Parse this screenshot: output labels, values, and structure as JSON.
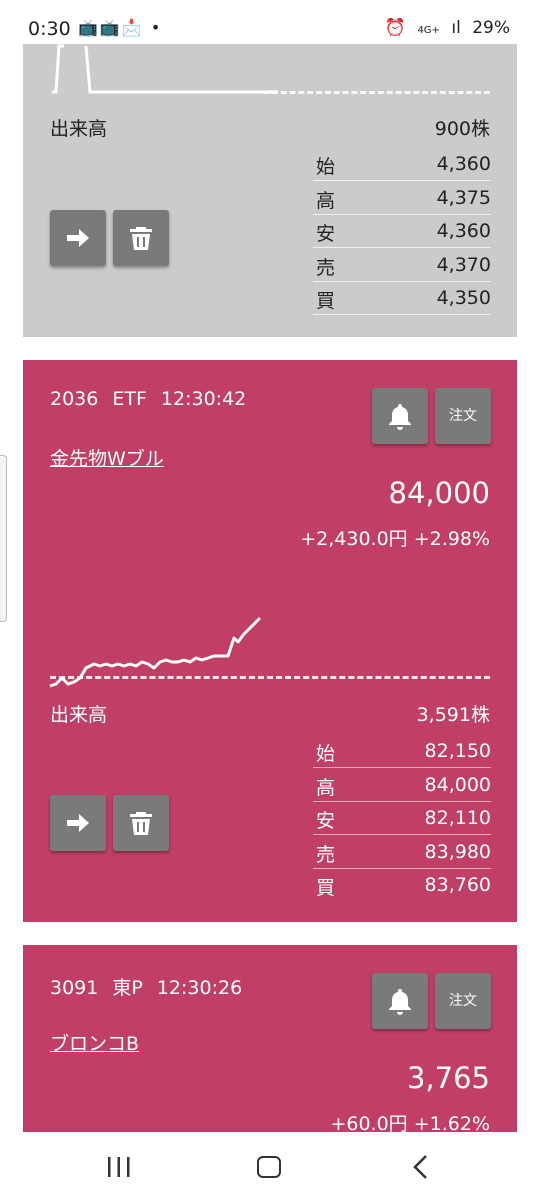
{
  "status_bar": {
    "time": "0:30",
    "notification_icons": "📺📺📩 •",
    "network": "4G+",
    "signal": "ıl",
    "battery": "29%"
  },
  "cards": [
    {
      "volume_label": "出来高",
      "volume_value": "900株",
      "ohlc": [
        {
          "k": "始",
          "v": "4,360"
        },
        {
          "k": "高",
          "v": "4,375"
        },
        {
          "k": "安",
          "v": "4,360"
        },
        {
          "k": "売",
          "v": "4,370"
        },
        {
          "k": "買",
          "v": "4,350"
        }
      ]
    },
    {
      "code": "2036",
      "market": "ETF",
      "time": "12:30:42",
      "name": "金先物Wブル",
      "price": "84,000",
      "change": "+2,430.0円 +2.98%",
      "order_label": "注文",
      "volume_label": "出来高",
      "volume_value": "3,591株",
      "ohlc": [
        {
          "k": "始",
          "v": "82,150"
        },
        {
          "k": "高",
          "v": "84,000"
        },
        {
          "k": "安",
          "v": "82,110"
        },
        {
          "k": "売",
          "v": "83,980"
        },
        {
          "k": "買",
          "v": "83,760"
        }
      ]
    },
    {
      "code": "3091",
      "market": "東P",
      "time": "12:30:26",
      "name": "ブロンコB",
      "price": "3,765",
      "change": "+60.0円 +1.62%",
      "order_label": "注文"
    }
  ],
  "colors": {
    "card_up": "#c13f66",
    "card_gray": "#cbcbcb",
    "button": "#7a7a7a"
  },
  "icons": [
    "bell-icon",
    "arrow-right-icon",
    "trash-icon",
    "recent-apps-icon",
    "home-icon",
    "back-icon"
  ]
}
